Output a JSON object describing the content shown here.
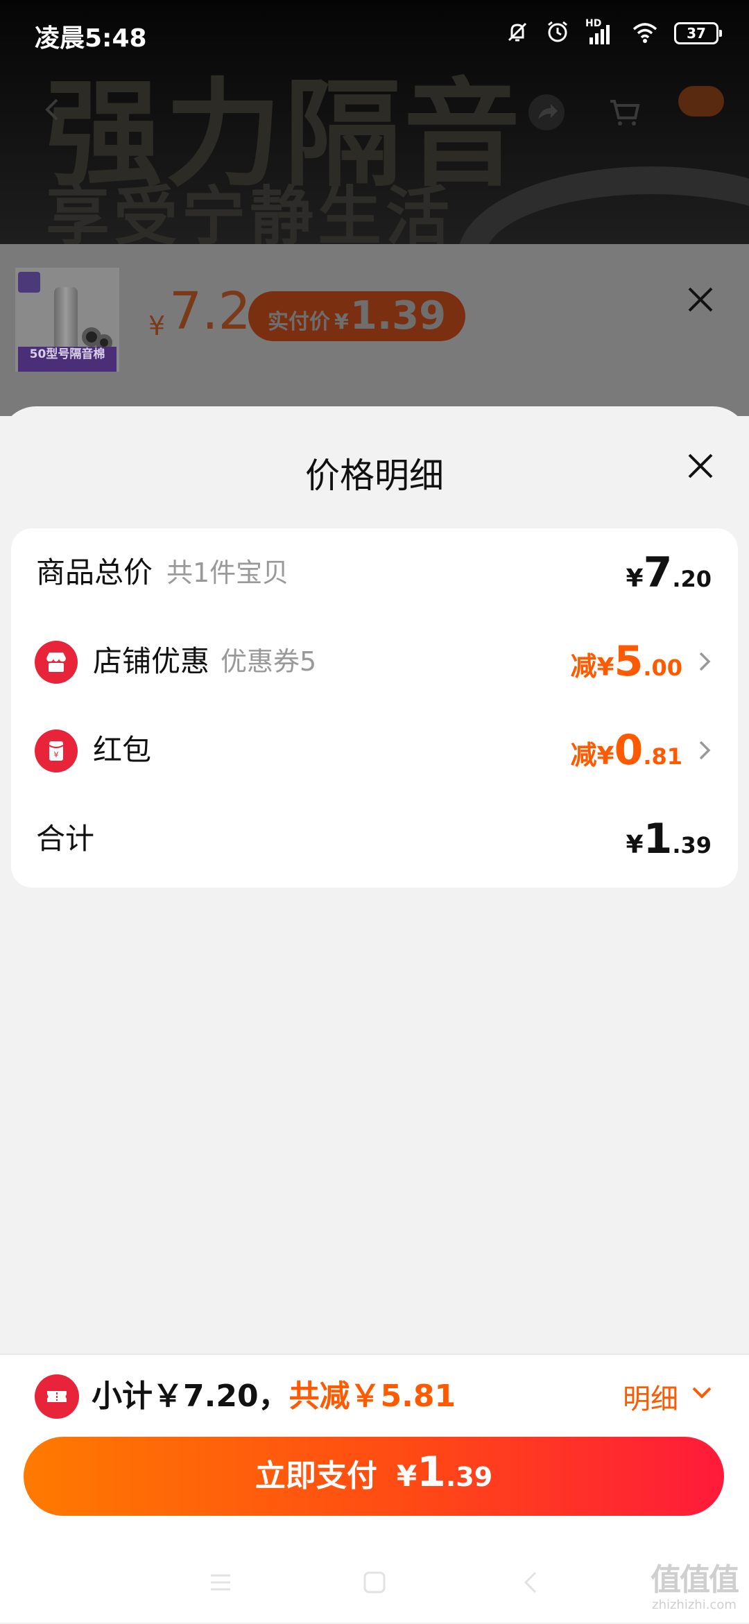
{
  "status_bar": {
    "time": "凌晨5:48",
    "network_label": "HD",
    "battery_level": "37"
  },
  "banner": {
    "headline": "强力隔音",
    "subline": "享受宁静生活"
  },
  "product_strip": {
    "thumbnail_caption": "50型号隔音棉",
    "price_symbol": "¥",
    "price": "7.2",
    "paid_label": "实付价",
    "paid_symbol": "¥",
    "paid_amount": "1.39"
  },
  "sheet": {
    "title": "价格明细",
    "rows": [
      {
        "label": "商品总价",
        "sub": "共1件宝贝",
        "prefix": "",
        "symbol": "¥",
        "integer": "7",
        "decimal": ".20"
      },
      {
        "label": "店铺优惠",
        "sub": "优惠券5",
        "prefix": "减",
        "symbol": "¥",
        "integer": "5",
        "decimal": ".00"
      },
      {
        "label": "红包",
        "sub": "",
        "prefix": "减",
        "symbol": "¥",
        "integer": "0",
        "decimal": ".81"
      },
      {
        "label": "合计",
        "sub": "",
        "prefix": "",
        "symbol": "¥",
        "integer": "1",
        "decimal": ".39"
      }
    ]
  },
  "bottom_bar": {
    "subtotal_text": "小计￥7.20，",
    "discount_text": "共减￥5.81",
    "detail_label": "明细",
    "pay_label": "立即支付",
    "pay_symbol": "¥",
    "pay_integer": "1",
    "pay_decimal": ".39"
  },
  "watermark": {
    "mark": "值值值",
    "text": "zhizhizhi.com"
  },
  "colors": {
    "accent_orange": "#ff5a00",
    "icon_red": "#e8243a",
    "pay_gradient_start": "#ff7a00",
    "pay_gradient_end": "#ff1a3a"
  }
}
